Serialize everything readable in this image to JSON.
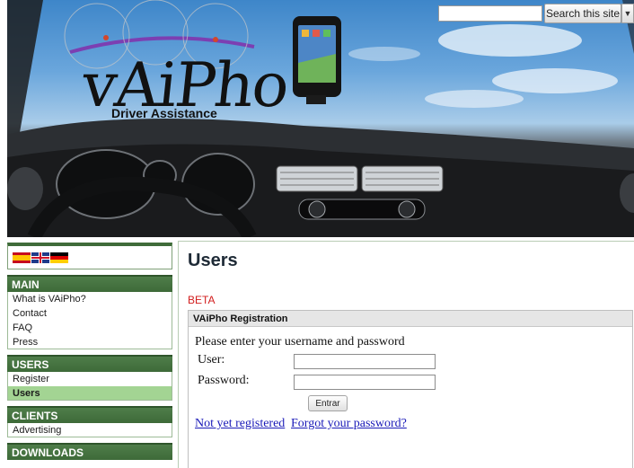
{
  "header": {
    "search_placeholder": "",
    "search_button": "Search this site",
    "search_dropdown_icon": "chevron-down-icon",
    "logo": "vAiPho",
    "tagline": "Driver Assistance"
  },
  "sidebar": {
    "languages": [
      "es",
      "en",
      "de"
    ],
    "sections": [
      {
        "title": "MAIN",
        "items": [
          {
            "label": "What is VAiPho?",
            "active": false
          },
          {
            "label": "Contact",
            "active": false
          },
          {
            "label": "FAQ",
            "active": false
          },
          {
            "label": "Press",
            "active": false
          }
        ]
      },
      {
        "title": "USERS",
        "items": [
          {
            "label": "Register",
            "active": false
          },
          {
            "label": "Users",
            "active": true
          }
        ]
      },
      {
        "title": "CLIENTS",
        "items": [
          {
            "label": "Advertising",
            "active": false
          }
        ]
      },
      {
        "title": "DOWNLOADS",
        "items": []
      }
    ]
  },
  "main": {
    "title": "Users",
    "beta": "BETA",
    "registration": {
      "heading": "VAiPho Registration",
      "prompt": "Please enter your username and password",
      "user_label": "User:",
      "password_label": "Password:",
      "user_value": "",
      "password_value": "",
      "submit_label": "Entrar",
      "register_link": "Not yet registered",
      "forgot_link": "Forgot your password?"
    }
  },
  "colors": {
    "menu_header": "#3e6a39",
    "active_item": "#a3d493",
    "beta": "#d21d1d",
    "link": "#1a1ab8"
  }
}
